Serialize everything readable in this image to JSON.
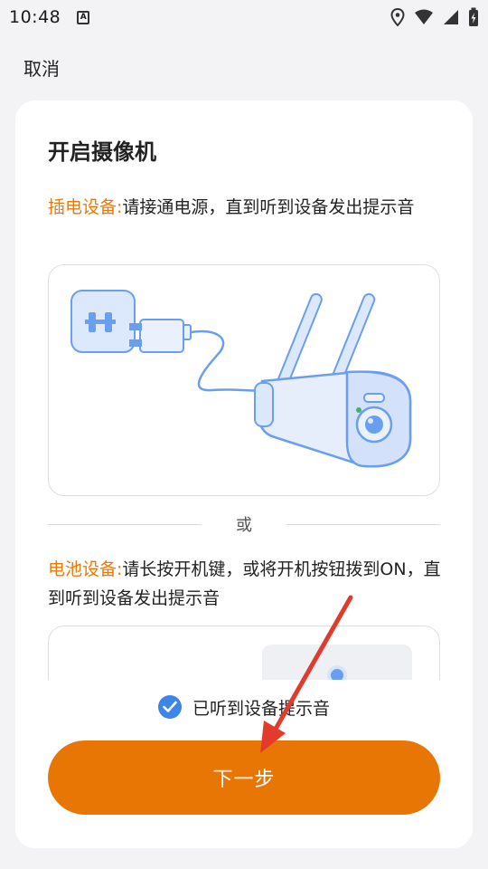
{
  "status_bar": {
    "time": "10:48",
    "notification_icon": "font-a-icon",
    "icons": [
      "location-icon",
      "wifi-icon",
      "signal-icon",
      "battery-charging-icon"
    ]
  },
  "header": {
    "cancel_label": "取消"
  },
  "main": {
    "title": "开启摄像机",
    "plug_in": {
      "highlight": "插电设备:",
      "text": "请接通电源，直到听到设备发出提示音"
    },
    "divider_label": "或",
    "battery": {
      "highlight": "电池设备:",
      "text": "请长按开机键，或将开机按钮拨到ON，直到听到设备发出提示音"
    }
  },
  "confirm": {
    "checked": true,
    "label": "已听到设备提示音"
  },
  "next_button": {
    "label": "下一步"
  },
  "colors": {
    "accent": "#e87605",
    "highlight_text": "#ea7a07",
    "check": "#3e85e8",
    "illustration_blue": "#6a9ff0",
    "annotation_arrow": "#e23b2e"
  }
}
